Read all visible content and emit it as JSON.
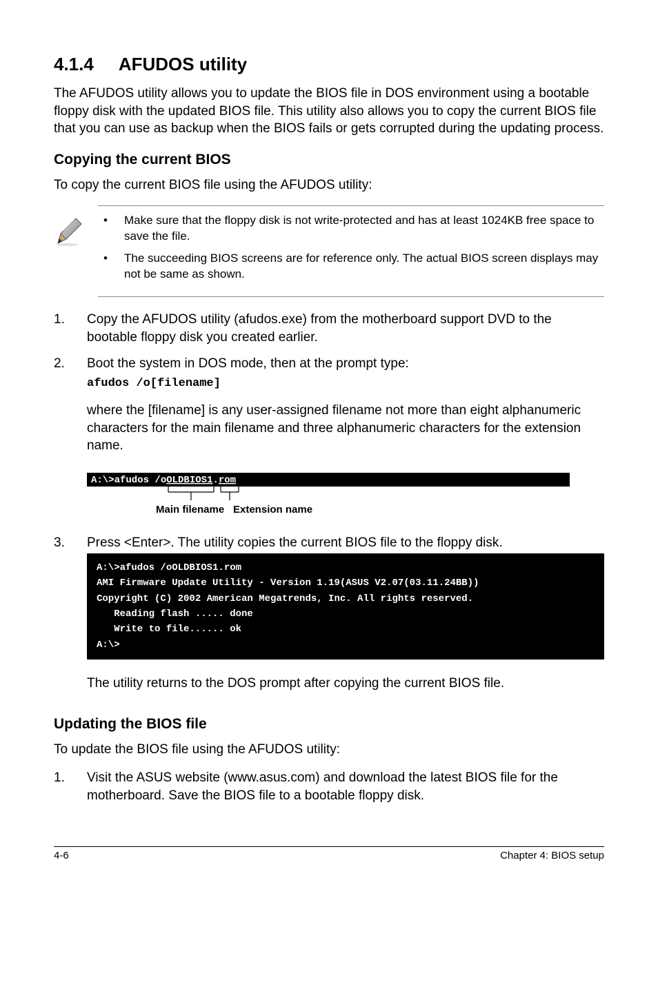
{
  "section": {
    "number": "4.1.4",
    "title": "AFUDOS utility"
  },
  "intro": "The AFUDOS utility allows you to update the BIOS file in DOS environment using a bootable floppy disk with the updated BIOS file. This utility also allows you to copy the current BIOS file that you can use as backup when the BIOS fails or gets corrupted during the updating process.",
  "copying": {
    "heading": "Copying the current BIOS",
    "lead": "To copy the current BIOS file using the AFUDOS utility:",
    "notes": [
      "Make sure that the floppy disk is not write-protected and has at least 1024KB free space to save the file.",
      "The succeeding BIOS screens are for reference only. The actual BIOS screen displays may not be same as shown."
    ],
    "steps": {
      "s1": {
        "num": "1.",
        "text": "Copy the AFUDOS utility (afudos.exe) from the motherboard support DVD to the bootable floppy disk you created earlier."
      },
      "s2": {
        "num": "2.",
        "text": "Boot the system in DOS mode, then at the prompt type:",
        "code": "afudos /o[filename]",
        "after": "where the [filename] is any user-assigned filename not more than eight alphanumeric characters  for the main filename and three alphanumeric characters for the extension name."
      },
      "s3": {
        "num": "3.",
        "text": "Press <Enter>. The utility copies the current BIOS file to the floppy disk."
      }
    },
    "annotated_cmd": {
      "cmd": "A:\\>afudos /oOLDBIOS1.rom",
      "main_label": "Main filename",
      "ext_label": "Extension name"
    },
    "terminal_lines": [
      "A:\\>afudos /oOLDBIOS1.rom",
      "AMI Firmware Update Utility - Version 1.19(ASUS V2.07(03.11.24BB))",
      "Copyright (C) 2002 American Megatrends, Inc. All rights reserved.",
      "   Reading flash ..... done",
      "   Write to file...... ok",
      "A:\\>"
    ],
    "after_terminal": "The utility returns to the DOS prompt after copying the current BIOS file."
  },
  "updating": {
    "heading": "Updating the BIOS file",
    "lead": "To update the BIOS file using the AFUDOS utility:",
    "steps": {
      "s1": {
        "num": "1.",
        "text": "Visit the ASUS website (www.asus.com) and download the latest BIOS file for the motherboard. Save the BIOS file to a bootable floppy disk."
      }
    }
  },
  "footer": {
    "left": "4-6",
    "right": "Chapter 4: BIOS setup"
  }
}
